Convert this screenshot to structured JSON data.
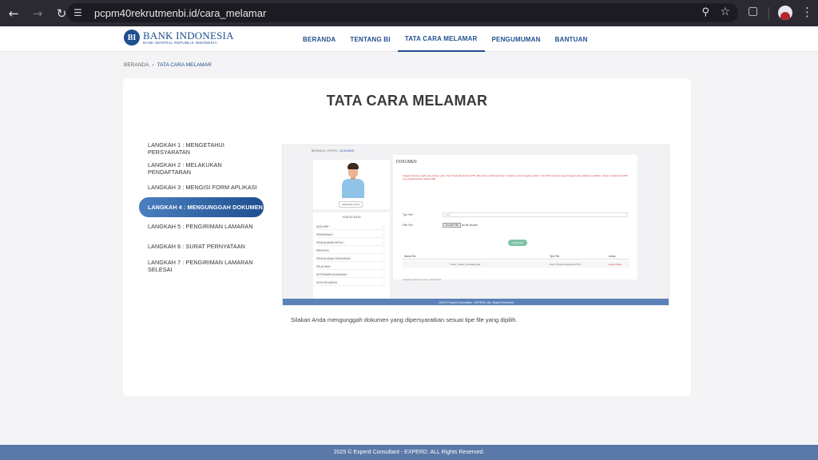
{
  "browser": {
    "url": "pcpm40rekrutmenbi.id/cara_melamar",
    "icons": [
      "back-icon",
      "forward-icon",
      "reload-icon",
      "site-info-icon",
      "zoom-icon",
      "star-icon",
      "extensions-icon",
      "profile-icon",
      "menu-icon"
    ]
  },
  "header": {
    "logo_name": "BANK INDONESIA",
    "logo_sub": "BANK SENTRAL REPUBLIK INDONESIA",
    "logo_mark": "BI",
    "nav": [
      "BERANDA",
      "TENTANG BI",
      "TATA CARA MELAMAR",
      "PENGUMUMAN",
      "BANTUAN"
    ],
    "active_nav": "TATA CARA MELAMAR",
    "brand_color": "#1f4f8f"
  },
  "breadcrumb": {
    "home": "BERANDA",
    "separator": "›",
    "current": "TATA CARA MELAMAR"
  },
  "page": {
    "title": "TATA CARA MELAMAR",
    "steps": [
      "LANGKAH 1 : MENGETAHUI PERSYARATAN",
      "LANGKAH 2 : MELAKUKAN PENDAFTARAN",
      "LANGKAH 3 : MENGISI FORM APLIKASI",
      "LANGKAH 4 : MENGUNGGAH DOKUMEN",
      "LANGKAH 5 : PENGIRIMAN LAMARAN",
      "LANGKAH 6 : SURAT PERNYATAAN",
      "LANGKAH 7 : PENGIRIMAN LAMARAN SELESAI"
    ],
    "active_step": 3,
    "caption": "Silakan Anda mengunggah dokumen yang dipersyaratkan sesuai tipe file yang dipilih."
  },
  "screenshot": {
    "breadcrumb_home": "BERANDA",
    "breadcrumb_mid": "PROFIL",
    "breadcrumb_current": "DOKUMEN",
    "upload_photo": "UNGGAH FOTO",
    "status_title": "STATUS DATA",
    "status_items": [
      {
        "label": "DATA DIRI *",
        "done": true
      },
      {
        "label": "PENDIDIKAN *",
        "done": true
      },
      {
        "label": "PENGALAMAN KERJA *",
        "done": true
      },
      {
        "label": "PRESTASI",
        "done": false
      },
      {
        "label": "PENGALAMAN ORGANISASI",
        "done": false
      },
      {
        "label": "PELATIHAN",
        "done": false
      },
      {
        "label": "KETERAMPILAN BAHASA",
        "done": false
      },
      {
        "label": "DATA KELUARGA",
        "done": false
      }
    ],
    "doc_title": "DOKUMEN",
    "note": "Unggah dokumen wajib yang diminta, yaitu: Kartu Tanda Penduduk (KTP). Bila Anda memiliki lebih dari 1 halaman mohon digabung dalam 1 file PDF. Dokumen yang diunggah akan dilakukan verifikasi. Ukuran maksimal file PDF yang diperkenankan adalah 1MB.",
    "type_label": "Tipe File *",
    "type_placeholder": "Pilih",
    "file_label": "Pilih File *",
    "choose_label": "Choose File",
    "no_file": "No file chosen",
    "upload_button": "UNGGAH",
    "table_headers": [
      "Nama File",
      "Tipe File",
      "Action"
    ],
    "table_row": [
      "Kartu_Tanda_Penduduk.pdf",
      "Kartu Tanda Penduduk (KTP)",
      "Hapus Data"
    ],
    "small_note": "Terakhir diperbarui data: 15/01/2025",
    "footer": "2025 © Experd Consultant - EXPERD. ALL Rights Reserved."
  },
  "footer": {
    "text": "2025 © Experd Consultant - EXPERD. ALL Rights Reserved."
  }
}
